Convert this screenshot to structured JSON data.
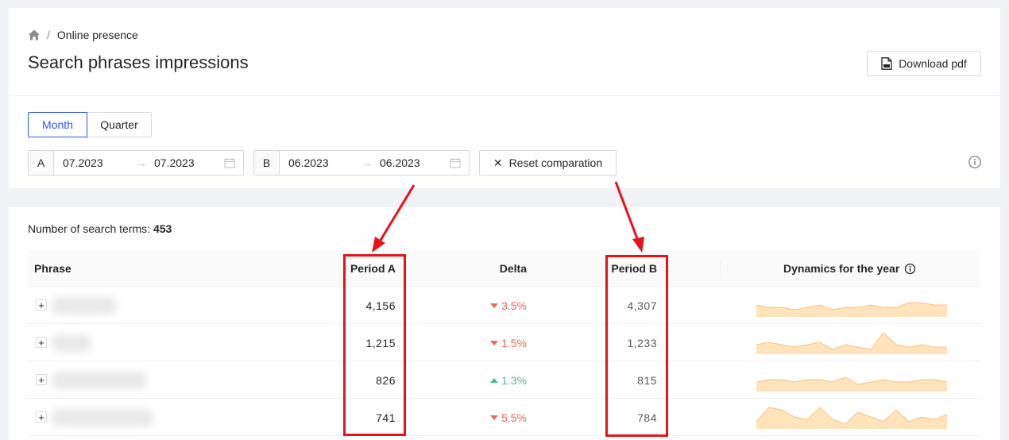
{
  "breadcrumb": {
    "home_icon": "home-icon",
    "current": "Online presence"
  },
  "page": {
    "title": "Search phrases impressions"
  },
  "toolbar": {
    "download_label": "Download pdf",
    "download_icon": "file-pdf-icon"
  },
  "period_toggle": {
    "options": [
      "Month",
      "Quarter"
    ],
    "selected": "Month"
  },
  "range_a": {
    "label": "A",
    "from": "07.2023",
    "to": "07.2023"
  },
  "range_b": {
    "label": "B",
    "from": "06.2023",
    "to": "06.2023"
  },
  "range_arrow": "→",
  "reset": {
    "label": "Reset comparation",
    "icon": "close-icon"
  },
  "summary": {
    "label": "Number of search terms:",
    "count": "453"
  },
  "table": {
    "headers": {
      "phrase": "Phrase",
      "period_a": "Period A",
      "delta": "Delta",
      "period_b": "Period B",
      "dynamics": "Dynamics for the year"
    },
    "rows": [
      {
        "period_a": "4,156",
        "delta": "3.5%",
        "direction": "down",
        "period_b": "4,307",
        "spark": [
          5,
          4,
          4,
          3,
          4,
          5,
          3,
          4,
          4,
          5,
          4,
          4,
          6,
          6,
          5,
          5
        ]
      },
      {
        "period_a": "1,215",
        "delta": "1.5%",
        "direction": "down",
        "period_b": "1,233",
        "spark": [
          4,
          5,
          4,
          3,
          4,
          5,
          2,
          4,
          3,
          2,
          9,
          4,
          3,
          4,
          3,
          3
        ]
      },
      {
        "period_a": "826",
        "delta": "1.3%",
        "direction": "up",
        "period_b": "815",
        "spark": [
          4,
          5,
          5,
          4,
          5,
          5,
          4,
          6,
          3,
          4,
          5,
          4,
          4,
          5,
          5,
          4
        ]
      },
      {
        "period_a": "741",
        "delta": "5.5%",
        "direction": "down",
        "period_b": "784",
        "spark": [
          3,
          9,
          8,
          5,
          4,
          9,
          4,
          2,
          7,
          5,
          3,
          8,
          3,
          5,
          4,
          6
        ]
      }
    ]
  },
  "colors": {
    "accent": "#2f54eb",
    "down": "#e8695b",
    "up": "#52b788",
    "spark_fill": "#ffe3bb",
    "spark_line": "#f9c37c",
    "highlight": "#e8121b"
  }
}
